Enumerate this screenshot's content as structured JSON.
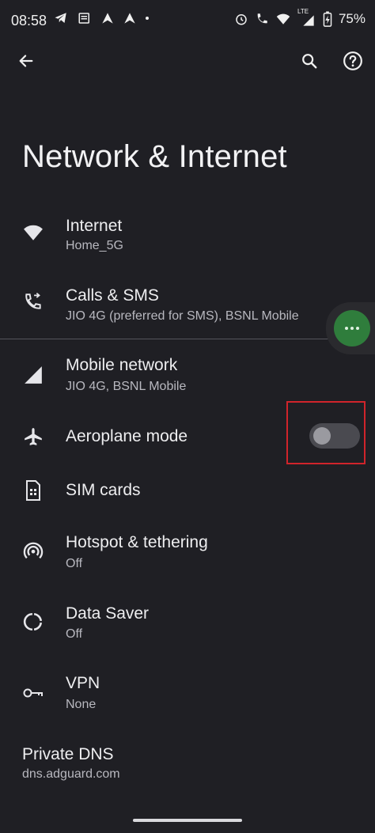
{
  "status_bar": {
    "time": "08:58",
    "lte_label": "LTE",
    "battery": "75%",
    "icons_left": [
      "telegram-icon",
      "news-icon",
      "arrow-up-icon",
      "arrow-up-icon",
      "dot-icon"
    ],
    "icons_right": [
      "alarm-icon",
      "wifi-call-icon",
      "wifi-icon",
      "signal-icon",
      "battery-charging-icon"
    ]
  },
  "toolbar": {
    "back_icon": "arrow-left-icon",
    "search_icon": "search-icon",
    "help_icon": "help-icon"
  },
  "page": {
    "title": "Network & Internet"
  },
  "items": [
    {
      "label": "Internet",
      "sub": "Home_5G",
      "icon": "wifi-icon"
    },
    {
      "label": "Calls & SMS",
      "sub": "JIO 4G (preferred for SMS), BSNL Mobile",
      "icon": "phone-icon"
    },
    {
      "label": "Mobile network",
      "sub": "JIO 4G, BSNL Mobile",
      "icon": "signal-icon"
    },
    {
      "label": "Aeroplane mode",
      "sub": "",
      "icon": "airplane-icon",
      "toggle": false
    },
    {
      "label": "SIM cards",
      "sub": "",
      "icon": "sim-card-icon"
    },
    {
      "label": "Hotspot & tethering",
      "sub": "Off",
      "icon": "hotspot-icon"
    },
    {
      "label": "Data Saver",
      "sub": "Off",
      "icon": "data-saver-icon"
    },
    {
      "label": "VPN",
      "sub": "None",
      "icon": "key-icon"
    }
  ],
  "private_dns": {
    "label": "Private DNS",
    "sub": "dns.adguard.com"
  },
  "colors": {
    "background": "#1f1f24",
    "fab": "#2f7d3c",
    "highlight": "#d0242b"
  }
}
